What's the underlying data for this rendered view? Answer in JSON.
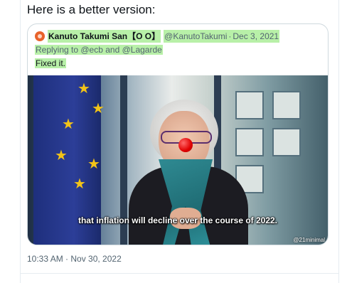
{
  "heading": "Here is a better version:",
  "quote": {
    "name": "Kanuto Takumi San【O O】",
    "handle": "@KanutoTakumi",
    "separator": "·",
    "date": "Dec 3, 2021",
    "replying_to": "Replying to @ecb and @Lagarde",
    "text": "Fixed it."
  },
  "video": {
    "subtitle": "that inflation will decline over the course of 2022.",
    "watermark": "@21minimal"
  },
  "tweet": {
    "timestamp": "10:33 AM · Nov 30, 2022"
  },
  "colors": {
    "highlight": "#b8f0a8",
    "secondary_text": "#536471",
    "clown_nose": "#e00000"
  }
}
